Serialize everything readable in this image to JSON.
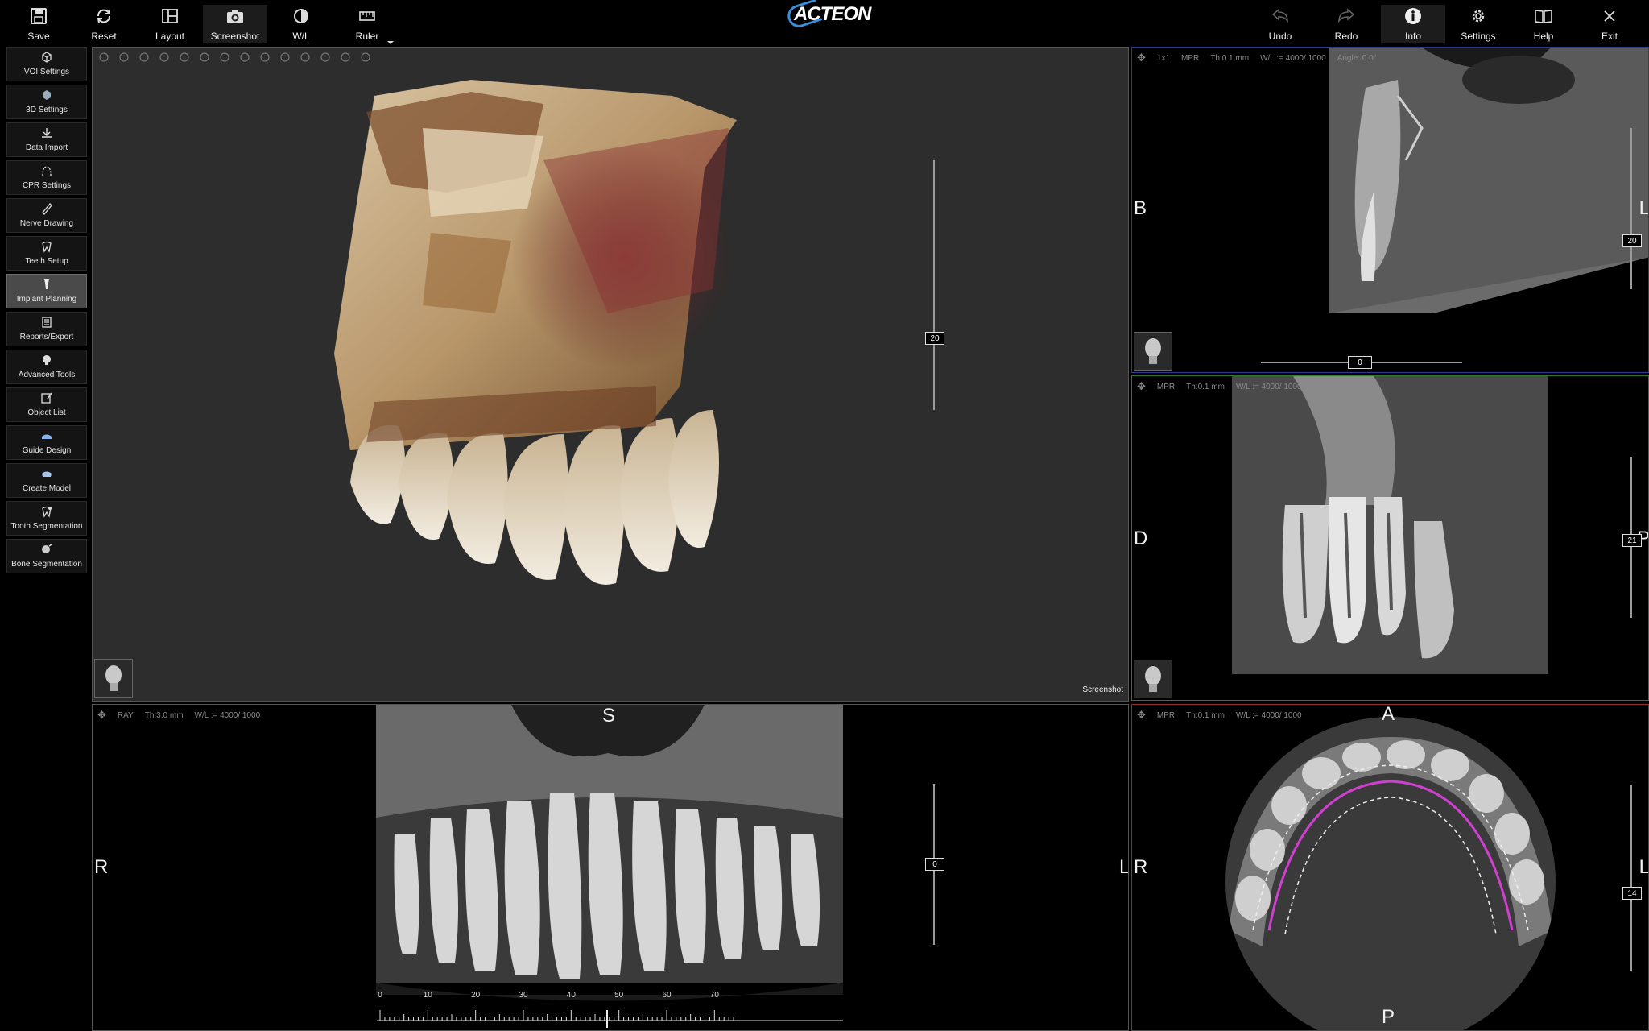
{
  "toolbar": {
    "left": [
      {
        "id": "save",
        "label": "Save",
        "icon": "floppy-disk-icon"
      },
      {
        "id": "reset",
        "label": "Reset",
        "icon": "refresh-icon"
      },
      {
        "id": "layout",
        "label": "Layout",
        "icon": "layout-grid-icon"
      },
      {
        "id": "screenshot",
        "label": "Screenshot",
        "icon": "camera-icon"
      },
      {
        "id": "wl",
        "label": "W/L",
        "icon": "contrast-icon"
      },
      {
        "id": "ruler",
        "label": "Ruler",
        "icon": "ruler-icon"
      }
    ],
    "right": [
      {
        "id": "undo",
        "label": "Undo",
        "icon": "undo-arrow-icon"
      },
      {
        "id": "redo",
        "label": "Redo",
        "icon": "redo-arrow-icon"
      },
      {
        "id": "info",
        "label": "Info",
        "icon": "info-icon"
      },
      {
        "id": "settings",
        "label": "Settings",
        "icon": "gear-icon"
      },
      {
        "id": "help",
        "label": "Help",
        "icon": "book-icon"
      },
      {
        "id": "exit",
        "label": "Exit",
        "icon": "close-icon"
      }
    ],
    "logo": "ACTEON"
  },
  "sidebar": {
    "items": [
      {
        "label": "VOI Settings",
        "icon": "cube-icon",
        "active": false
      },
      {
        "label": "3D Settings",
        "icon": "cube-3d-icon",
        "active": false
      },
      {
        "label": "Data Import",
        "icon": "download-icon",
        "active": false
      },
      {
        "label": "CPR Settings",
        "icon": "arch-curve-icon",
        "active": false
      },
      {
        "label": "Nerve Drawing",
        "icon": "nerve-pen-icon",
        "active": false
      },
      {
        "label": "Teeth Setup",
        "icon": "tooth-icon",
        "active": false
      },
      {
        "label": "Implant Planning",
        "icon": "implant-icon",
        "active": true
      },
      {
        "label": "Reports/Export",
        "icon": "report-icon",
        "active": false
      },
      {
        "label": "Advanced Tools",
        "icon": "skull-tool-icon",
        "active": false
      },
      {
        "label": "Object List",
        "icon": "edit-list-icon",
        "active": false
      },
      {
        "label": "Guide Design",
        "icon": "guide-icon",
        "active": false
      },
      {
        "label": "Create Model",
        "icon": "model-icon",
        "active": false
      },
      {
        "label": "Tooth Segmentation",
        "icon": "tooth-segment-icon",
        "active": false
      },
      {
        "label": "Bone Segmentation",
        "icon": "bone-segment-icon",
        "active": false
      }
    ]
  },
  "viewports": {
    "vr3d": {
      "slider_value": "20",
      "screenshot_label": "Screenshot",
      "toolbar_icons": [
        "move-icon",
        "radiation-icon",
        "implant-tool-icon",
        "sphere-icon",
        "tooth-tool-icon",
        "close-tool-icon",
        "implant-2-icon",
        "cut-icon",
        "comb-icon",
        "bracket-icon",
        "box-icon",
        "paint-icon",
        "knife-icon",
        "curve-icon"
      ]
    },
    "axial_top": {
      "info": [
        "1x1",
        "MPR",
        "Th:0.1 mm",
        "W/L := 4000/ 1000",
        "Angle: 0.0°"
      ],
      "left_orient": "B",
      "right_orient": "L",
      "slider_value": "20",
      "h_slider_value": "0"
    },
    "sagittal": {
      "info": [
        "MPR",
        "Th:0.1 mm",
        "W/L := 4000/ 1000"
      ],
      "left_orient": "D",
      "right_orient": "P",
      "slider_value": "21"
    },
    "panoramic": {
      "info": [
        "RAY",
        "Th:3.0 mm",
        "W/L := 4000/ 1000"
      ],
      "top_orient": "S",
      "left_orient": "R",
      "right_orient": "L",
      "slider_value": "0",
      "ruler_labels": [
        "0",
        "10",
        "20",
        "30",
        "40",
        "50",
        "60",
        "70"
      ]
    },
    "axial": {
      "info": [
        "MPR",
        "Th:0.1 mm",
        "W/L := 4000/ 1000"
      ],
      "top_orient": "A",
      "bottom_orient": "P",
      "left_orient": "R",
      "right_orient": "L",
      "slider_value": "14"
    }
  }
}
